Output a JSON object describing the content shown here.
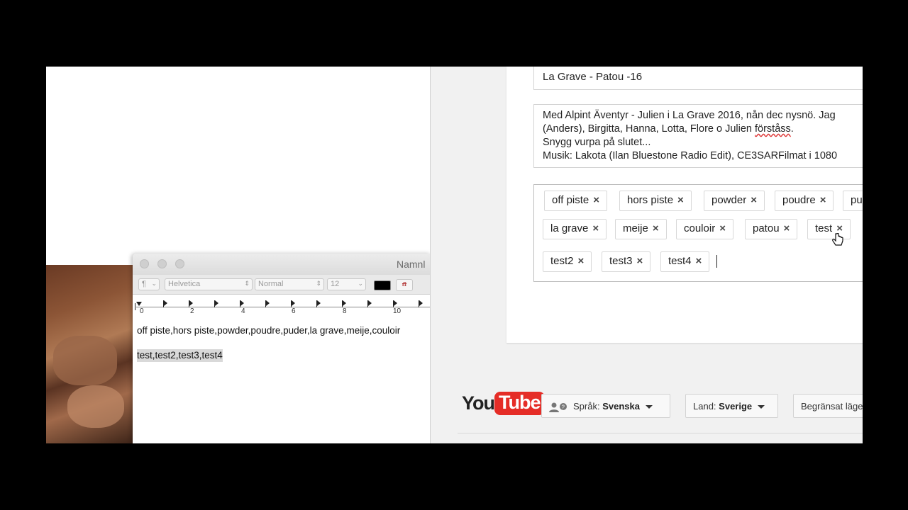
{
  "textedit": {
    "title": "Namnl",
    "toolbar": {
      "paragraph_style": "¶",
      "font_family": "Helvetica",
      "typeface": "Normal",
      "font_size": "12",
      "text_color": "#000000",
      "strike_label": "a"
    },
    "ruler_numbers": [
      "0",
      "2",
      "4",
      "6",
      "8",
      "10"
    ],
    "content": {
      "line1": "off piste,hors piste,powder,poudre,puder,la grave,meije,couloir",
      "line2": "test,test2,test3,test4"
    }
  },
  "youtube": {
    "title_value": "La Grave - Patou -16",
    "description_lines": [
      "Med Alpint Äventyr - Julien i La Grave 2016, nån dec nysnö. Jag",
      "(Anders), Birgitta, Hanna, Lotta, Flore o Julien förståss.",
      "Snygg vurpa på slutet...",
      "Musik: Lakota (Ilan Bluestone Radio Edit), CE3SARFilmat i 1080"
    ],
    "desc_underlined_word": "förståss",
    "tags": [
      "off piste",
      "hors piste",
      "powder",
      "poudre",
      "pu",
      "la grave",
      "meije",
      "couloir",
      "patou",
      "test",
      "test2",
      "test3",
      "test4"
    ],
    "tag_remove_glyph": "×",
    "footer": {
      "logo_you": "You",
      "logo_tube": "Tube",
      "language_label": "Språk:",
      "language_value": "Svenska",
      "country_label": "Land:",
      "country_value": "Sverige",
      "restricted_label": "Begränsat läge"
    },
    "colors": {
      "brand_red": "#e52d27"
    }
  }
}
